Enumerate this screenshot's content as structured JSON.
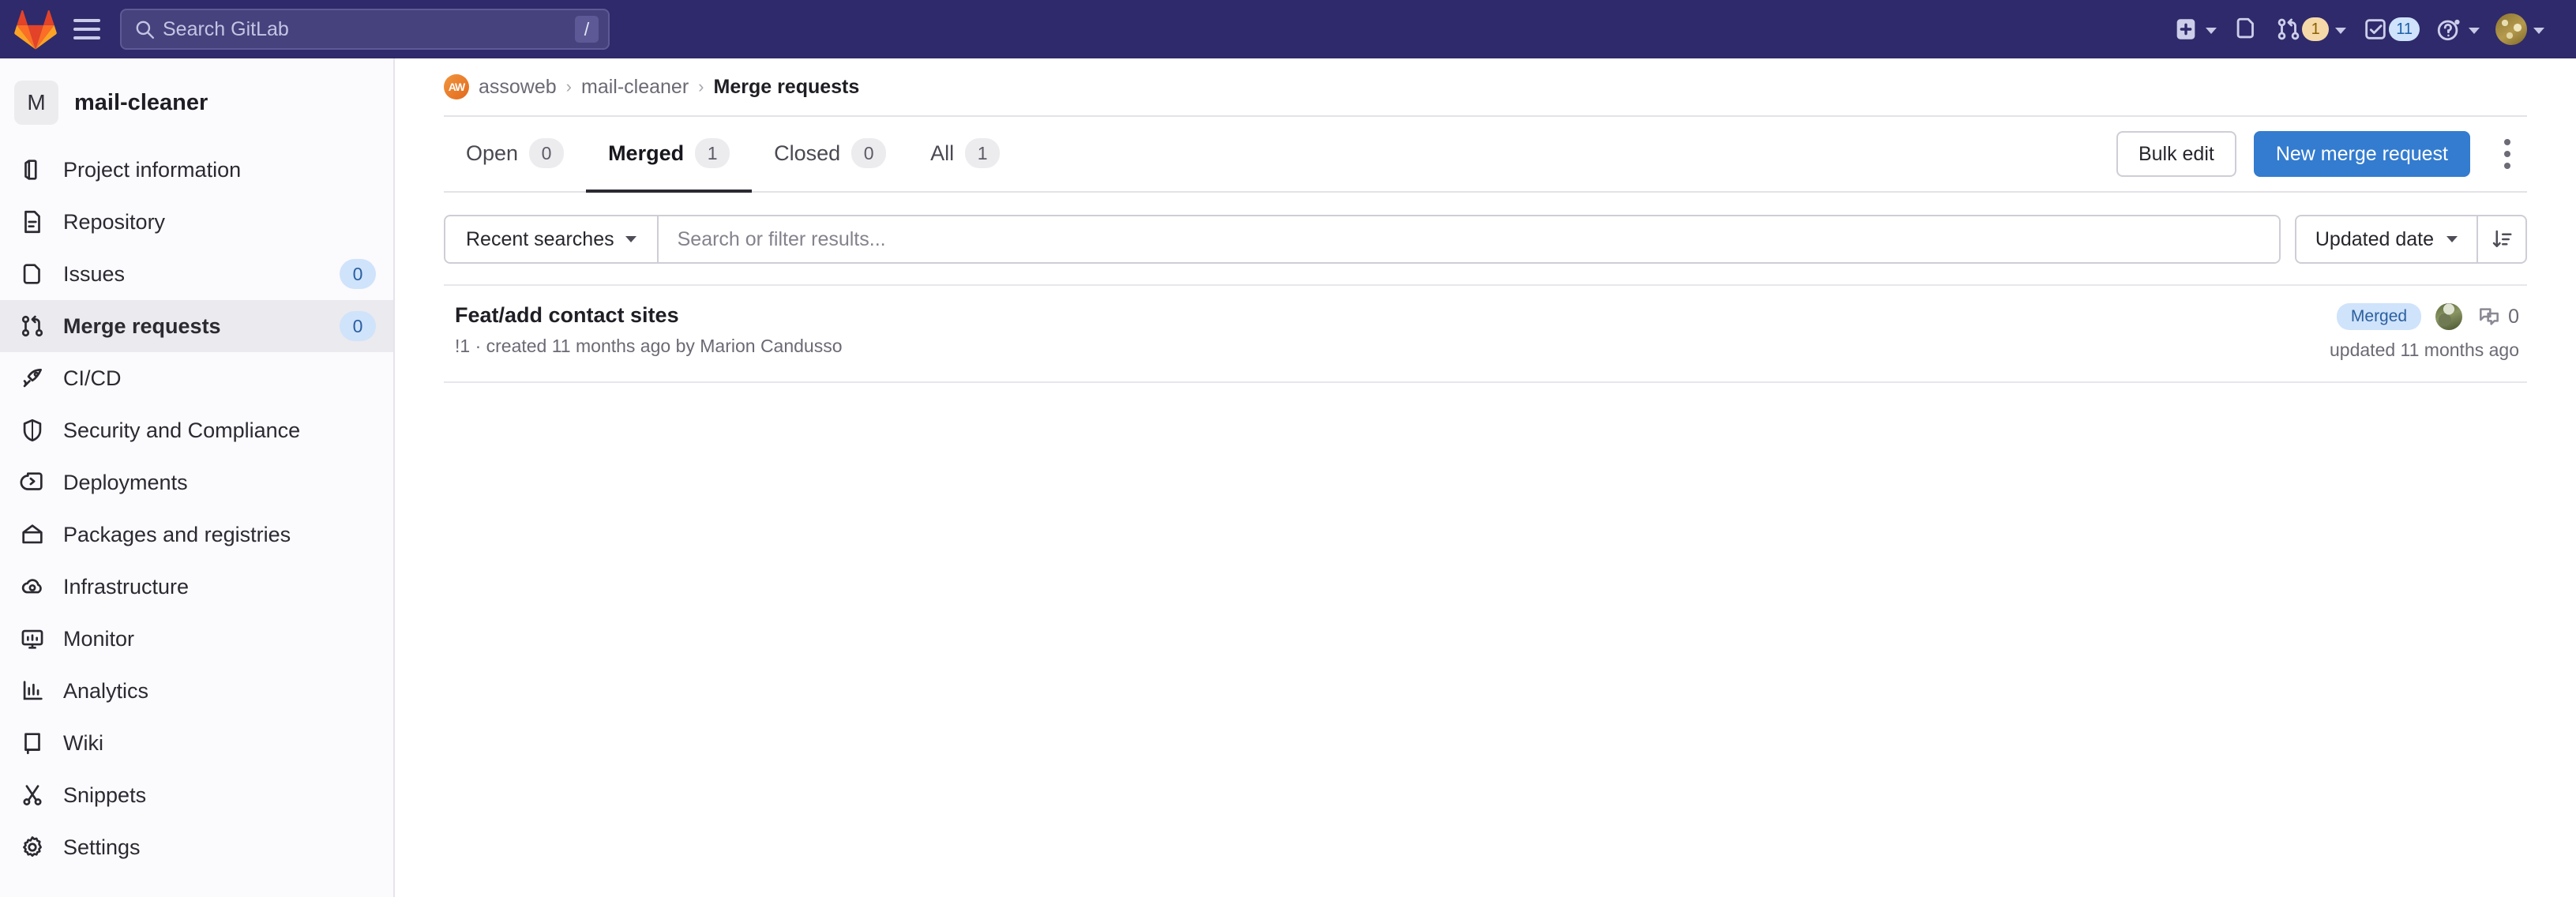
{
  "topbar": {
    "logo_icon": "gitlab-logo-icon",
    "menu_icon": "hamburger-menu-icon",
    "search": {
      "placeholder": "Search GitLab",
      "value": "",
      "icon": "search-icon",
      "shortcut_key": "/"
    },
    "items": [
      {
        "name": "create-new",
        "icon": "plus-square-icon",
        "has_dropdown": true,
        "badge": ""
      },
      {
        "name": "issues",
        "icon": "issues-icon",
        "has_dropdown": false,
        "badge": ""
      },
      {
        "name": "merge-requests",
        "icon": "merge-request-icon",
        "has_dropdown": true,
        "badge": "1"
      },
      {
        "name": "todos",
        "icon": "todo-check-icon",
        "has_dropdown": false,
        "badge": "11"
      },
      {
        "name": "help",
        "icon": "help-circle-icon",
        "has_dropdown": true,
        "badge": ""
      },
      {
        "name": "user-menu",
        "icon": "avatar",
        "has_dropdown": true,
        "badge": ""
      }
    ]
  },
  "sidebar": {
    "project_initial": "M",
    "project_name": "mail-cleaner",
    "items": [
      {
        "label": "Project information",
        "icon": "info-book-icon",
        "badge": "",
        "active": false
      },
      {
        "label": "Repository",
        "icon": "document-icon",
        "badge": "",
        "active": false
      },
      {
        "label": "Issues",
        "icon": "issues-icon",
        "badge": "0",
        "active": false
      },
      {
        "label": "Merge requests",
        "icon": "merge-request-icon",
        "badge": "0",
        "active": true
      },
      {
        "label": "CI/CD",
        "icon": "rocket-icon",
        "badge": "",
        "active": false
      },
      {
        "label": "Security and Compliance",
        "icon": "shield-icon",
        "badge": "",
        "active": false
      },
      {
        "label": "Deployments",
        "icon": "deployments-icon",
        "badge": "",
        "active": false
      },
      {
        "label": "Packages and registries",
        "icon": "package-icon",
        "badge": "",
        "active": false
      },
      {
        "label": "Infrastructure",
        "icon": "cloud-gear-icon",
        "badge": "",
        "active": false
      },
      {
        "label": "Monitor",
        "icon": "monitor-icon",
        "badge": "",
        "active": false
      },
      {
        "label": "Analytics",
        "icon": "chart-bar-icon",
        "badge": "",
        "active": false
      },
      {
        "label": "Wiki",
        "icon": "book-icon",
        "badge": "",
        "active": false
      },
      {
        "label": "Snippets",
        "icon": "snippet-scissors-icon",
        "badge": "",
        "active": false
      },
      {
        "label": "Settings",
        "icon": "gear-icon",
        "badge": "",
        "active": false
      }
    ]
  },
  "breadcrumb": {
    "avatar_initials": "AW",
    "group": "assoweb",
    "project": "mail-cleaner",
    "current": "Merge requests",
    "separator": "›"
  },
  "tabs": [
    {
      "label": "Open",
      "count": "0",
      "active": false
    },
    {
      "label": "Merged",
      "count": "1",
      "active": true
    },
    {
      "label": "Closed",
      "count": "0",
      "active": false
    },
    {
      "label": "All",
      "count": "1",
      "active": false
    }
  ],
  "actions": {
    "bulk_edit_label": "Bulk edit",
    "new_mr_label": "New merge request",
    "kebab_icon": "kebab-menu-icon"
  },
  "filters": {
    "recent_searches_label": "Recent searches",
    "search_placeholder": "Search or filter results...",
    "search_value": "",
    "sort_label": "Updated date",
    "sort_direction_icon": "sort-descending-icon"
  },
  "merge_requests": [
    {
      "title": "Feat/add contact sites",
      "meta": "!1 · created 11 months ago by Marion Candusso",
      "status": "Merged",
      "comment_count": "0",
      "updated": "updated 11 months ago"
    }
  ],
  "colors": {
    "topbar_bg": "#2f2a6b",
    "primary_button": "#337ccf",
    "badge_blue_bg": "#cfe3fb",
    "badge_blue_text": "#2b5f9e",
    "badge_amber_bg": "#f5d9a8",
    "sidebar_bg": "#fbfafd",
    "active_nav_bg": "#ebeaee"
  }
}
